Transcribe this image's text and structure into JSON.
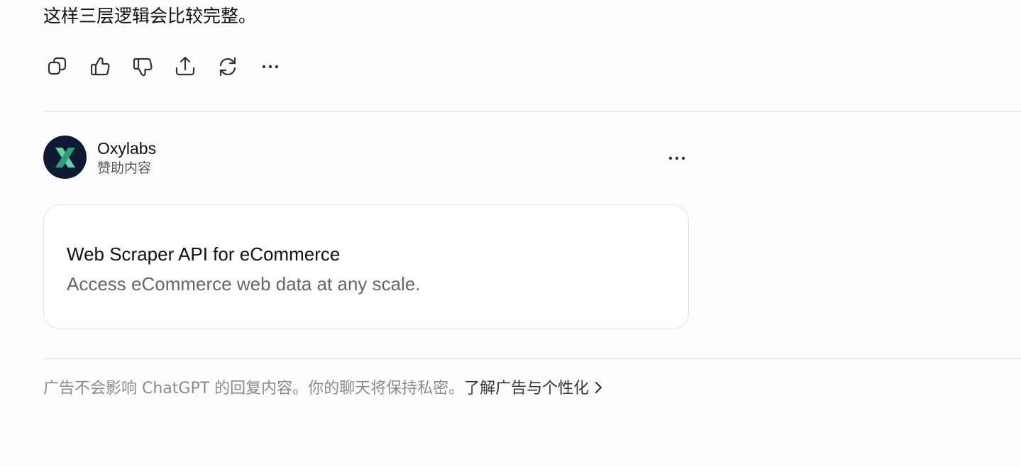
{
  "reply": {
    "text": "这样三层逻辑会比较完整。"
  },
  "actions": [
    {
      "name": "copy-icon"
    },
    {
      "name": "thumbs-up-icon"
    },
    {
      "name": "thumbs-down-icon"
    },
    {
      "name": "share-icon"
    },
    {
      "name": "regenerate-icon"
    },
    {
      "name": "more-horizontal-icon"
    }
  ],
  "sponsor": {
    "name": "Oxylabs",
    "label": "赞助内容",
    "logo_icon": "oxylabs-x-logo-icon",
    "logo_bg": "#101934",
    "logo_colors": [
      "#5fd6a0",
      "#2e9c7a"
    ]
  },
  "ad": {
    "title": "Web Scraper API for eCommerce",
    "description": "Access eCommerce web data at any scale."
  },
  "disclaimer": {
    "text": "广告不会影响 ChatGPT 的回复内容。你的聊天将保持私密。",
    "link_label": "了解广告与个性化"
  }
}
